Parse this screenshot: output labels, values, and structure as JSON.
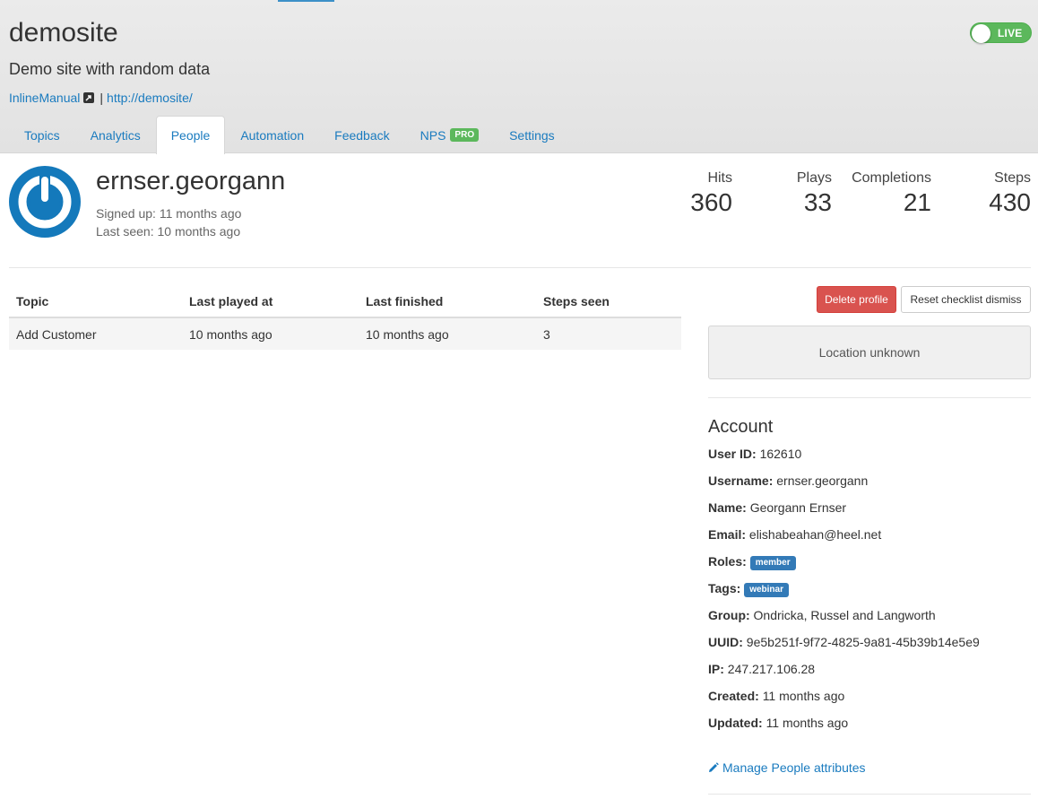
{
  "site": {
    "title": "demosite",
    "description": "Demo site with random data",
    "link_inlinemanual": "InlineManual",
    "separator": "|",
    "link_url": "http://demosite/",
    "status_toggle": "LIVE"
  },
  "tabs": [
    {
      "label": "Topics"
    },
    {
      "label": "Analytics"
    },
    {
      "label": "People",
      "active": true
    },
    {
      "label": "Automation"
    },
    {
      "label": "Feedback"
    },
    {
      "label": "NPS",
      "badge": "PRO"
    },
    {
      "label": "Settings"
    }
  ],
  "profile": {
    "username": "ernser.georgann",
    "signed_up": "Signed up: 11 months ago",
    "last_seen": "Last seen: 10 months ago"
  },
  "stats": {
    "hits": {
      "label": "Hits",
      "value": "360"
    },
    "plays": {
      "label": "Plays",
      "value": "33"
    },
    "completions": {
      "label": "Completions",
      "value": "21"
    },
    "steps": {
      "label": "Steps",
      "value": "430"
    }
  },
  "topics_table": {
    "headers": [
      "Topic",
      "Last played at",
      "Last finished",
      "Steps seen"
    ],
    "rows": [
      [
        "Add Customer",
        "10 months ago",
        "10 months ago",
        "3"
      ]
    ]
  },
  "actions": {
    "delete_profile": "Delete profile",
    "reset_checklist": "Reset checklist dismiss"
  },
  "location": "Location unknown",
  "account": {
    "title": "Account",
    "user_id": {
      "label": "User ID:",
      "value": "162610"
    },
    "username": {
      "label": "Username:",
      "value": "ernser.georgann"
    },
    "name": {
      "label": "Name:",
      "value": "Georgann Ernser"
    },
    "email": {
      "label": "Email:",
      "value": "elishabeahan@heel.net"
    },
    "roles": {
      "label": "Roles:",
      "value": "member"
    },
    "tags": {
      "label": "Tags:",
      "value": "webinar"
    },
    "group": {
      "label": "Group:",
      "value": "Ondricka, Russel and Langworth"
    },
    "uuid": {
      "label": "UUID:",
      "value": "9e5b251f-9f72-4825-9a81-45b39b14e5e9"
    },
    "ip": {
      "label": "IP:",
      "value": "247.217.106.28"
    },
    "created": {
      "label": "Created:",
      "value": "11 months ago"
    },
    "updated": {
      "label": "Updated:",
      "value": "11 months ago"
    }
  },
  "manage_link": "Manage People attributes",
  "colors": {
    "link": "#1a7bbf",
    "live_green": "#5cb85c",
    "danger": "#d9534f",
    "badge_blue": "#337ab7",
    "avatar_blue": "#1479bb"
  },
  "icons": {
    "external_link": "external-link-icon",
    "avatar": "power-icon",
    "manage": "pencil-icon"
  }
}
